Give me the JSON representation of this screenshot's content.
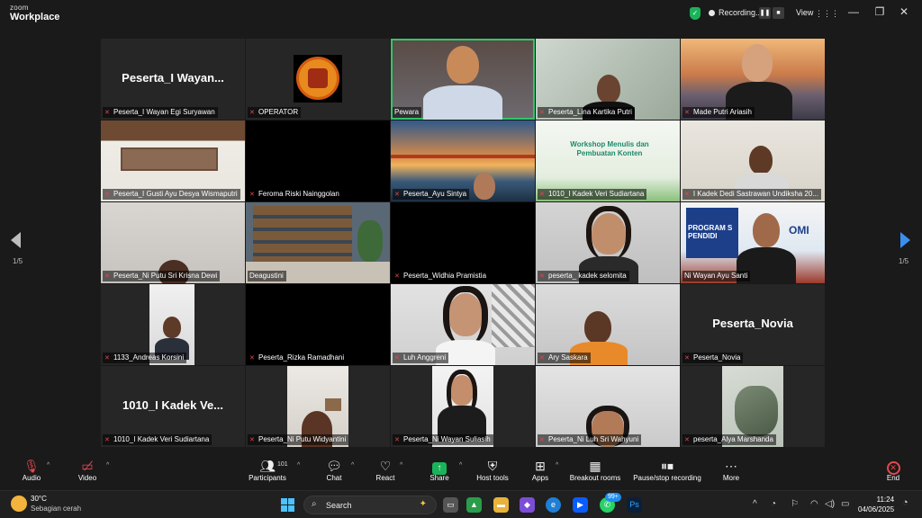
{
  "app": {
    "logo_top": "zoom",
    "logo_bottom": "Workplace"
  },
  "titlebar": {
    "recording_label": "Recording...",
    "pause_icon": "pause-icon",
    "stop_icon": "stop-icon",
    "view_label": "View",
    "view_icon": "grid-icon"
  },
  "participants": [
    {
      "name": "Peserta_I Wayan Egi Suryawan",
      "display": "Peserta_I  Wayan...",
      "mic_muted": true
    },
    {
      "name": "OPERATOR",
      "mic_muted": true
    },
    {
      "name": "Pewara",
      "mic_muted": false,
      "active_speaker": true
    },
    {
      "name": "Peserta_Lina Kartika Putri",
      "mic_muted": true
    },
    {
      "name": "Made Putri Ariasih",
      "mic_muted": true
    },
    {
      "name": "Peserta_I Gusti Ayu Desya Wismaputri",
      "mic_muted": true
    },
    {
      "name": "Feroma Riski Nainggolan",
      "mic_muted": true
    },
    {
      "name": "Peserta_Ayu Sintya",
      "mic_muted": true
    },
    {
      "name": "1010_I Kadek Veri Sudiartana",
      "mic_muted": true
    },
    {
      "name": "I Kadek Dedi Sastrawan Undiksha 20...",
      "mic_muted": true
    },
    {
      "name": "Peserta_Ni Putu Sri Krisna Dewi",
      "mic_muted": true
    },
    {
      "name": "Deagustini",
      "mic_muted": false
    },
    {
      "name": "Peserta_Widhia Pramistia",
      "mic_muted": true
    },
    {
      "name": "peserta_ kadek selomita",
      "mic_muted": true
    },
    {
      "name": "Ni Wayan Ayu Santi",
      "mic_muted": false
    },
    {
      "name": "1133_Andreas Korsini",
      "mic_muted": true
    },
    {
      "name": "Peserta_Rizka Ramadhani",
      "mic_muted": true
    },
    {
      "name": "Luh Anggreni",
      "mic_muted": true
    },
    {
      "name": "Ary Saskara",
      "mic_muted": true
    },
    {
      "name": "Peserta_Novia",
      "display": "Peserta_Novia",
      "mic_muted": true
    },
    {
      "name": "1010_I Kadek Veri Sudiartana",
      "display": "1010_I  Kadek  Ve...",
      "mic_muted": true
    },
    {
      "name": "Peserta_Ni Putu Widyantini",
      "mic_muted": true
    },
    {
      "name": "Peserta_Ni Wayan Suliasih",
      "mic_muted": true
    },
    {
      "name": "Peserta_Ni Luh Sri Wahyuni",
      "mic_muted": true
    },
    {
      "name": "peserta_Alya Marshanda",
      "mic_muted": true
    }
  ],
  "tile_text": {
    "workshop_line1": "Workshop Menulis dan",
    "workshop_line2": "Pembuatan Konten",
    "program_text": "PROGRAM S",
    "program_text2": "PENDIDI",
    "program_text3": "OMI"
  },
  "pagination": {
    "left": "1/5",
    "right": "1/5"
  },
  "toolbar": {
    "audio": "Audio",
    "video": "Video",
    "participants": "Participants",
    "participants_count": "101",
    "chat": "Chat",
    "react": "React",
    "share": "Share",
    "host_tools": "Host tools",
    "apps": "Apps",
    "breakout_rooms": "Breakout rooms",
    "pause_stop_recording": "Pause/stop recording",
    "more": "More",
    "end": "End"
  },
  "taskbar": {
    "temperature": "30°C",
    "weather_desc": "Sebagian cerah",
    "search_label": "Search",
    "whatsapp_badge": "99+",
    "ps_label": "Ps",
    "time": "11:24",
    "date": "04/06/2025"
  },
  "colors": {
    "active_speaker_border": "#36c46a",
    "share_green": "#1bb35a",
    "end_red": "#e5484d",
    "nav_blue": "#3a8ef0"
  }
}
